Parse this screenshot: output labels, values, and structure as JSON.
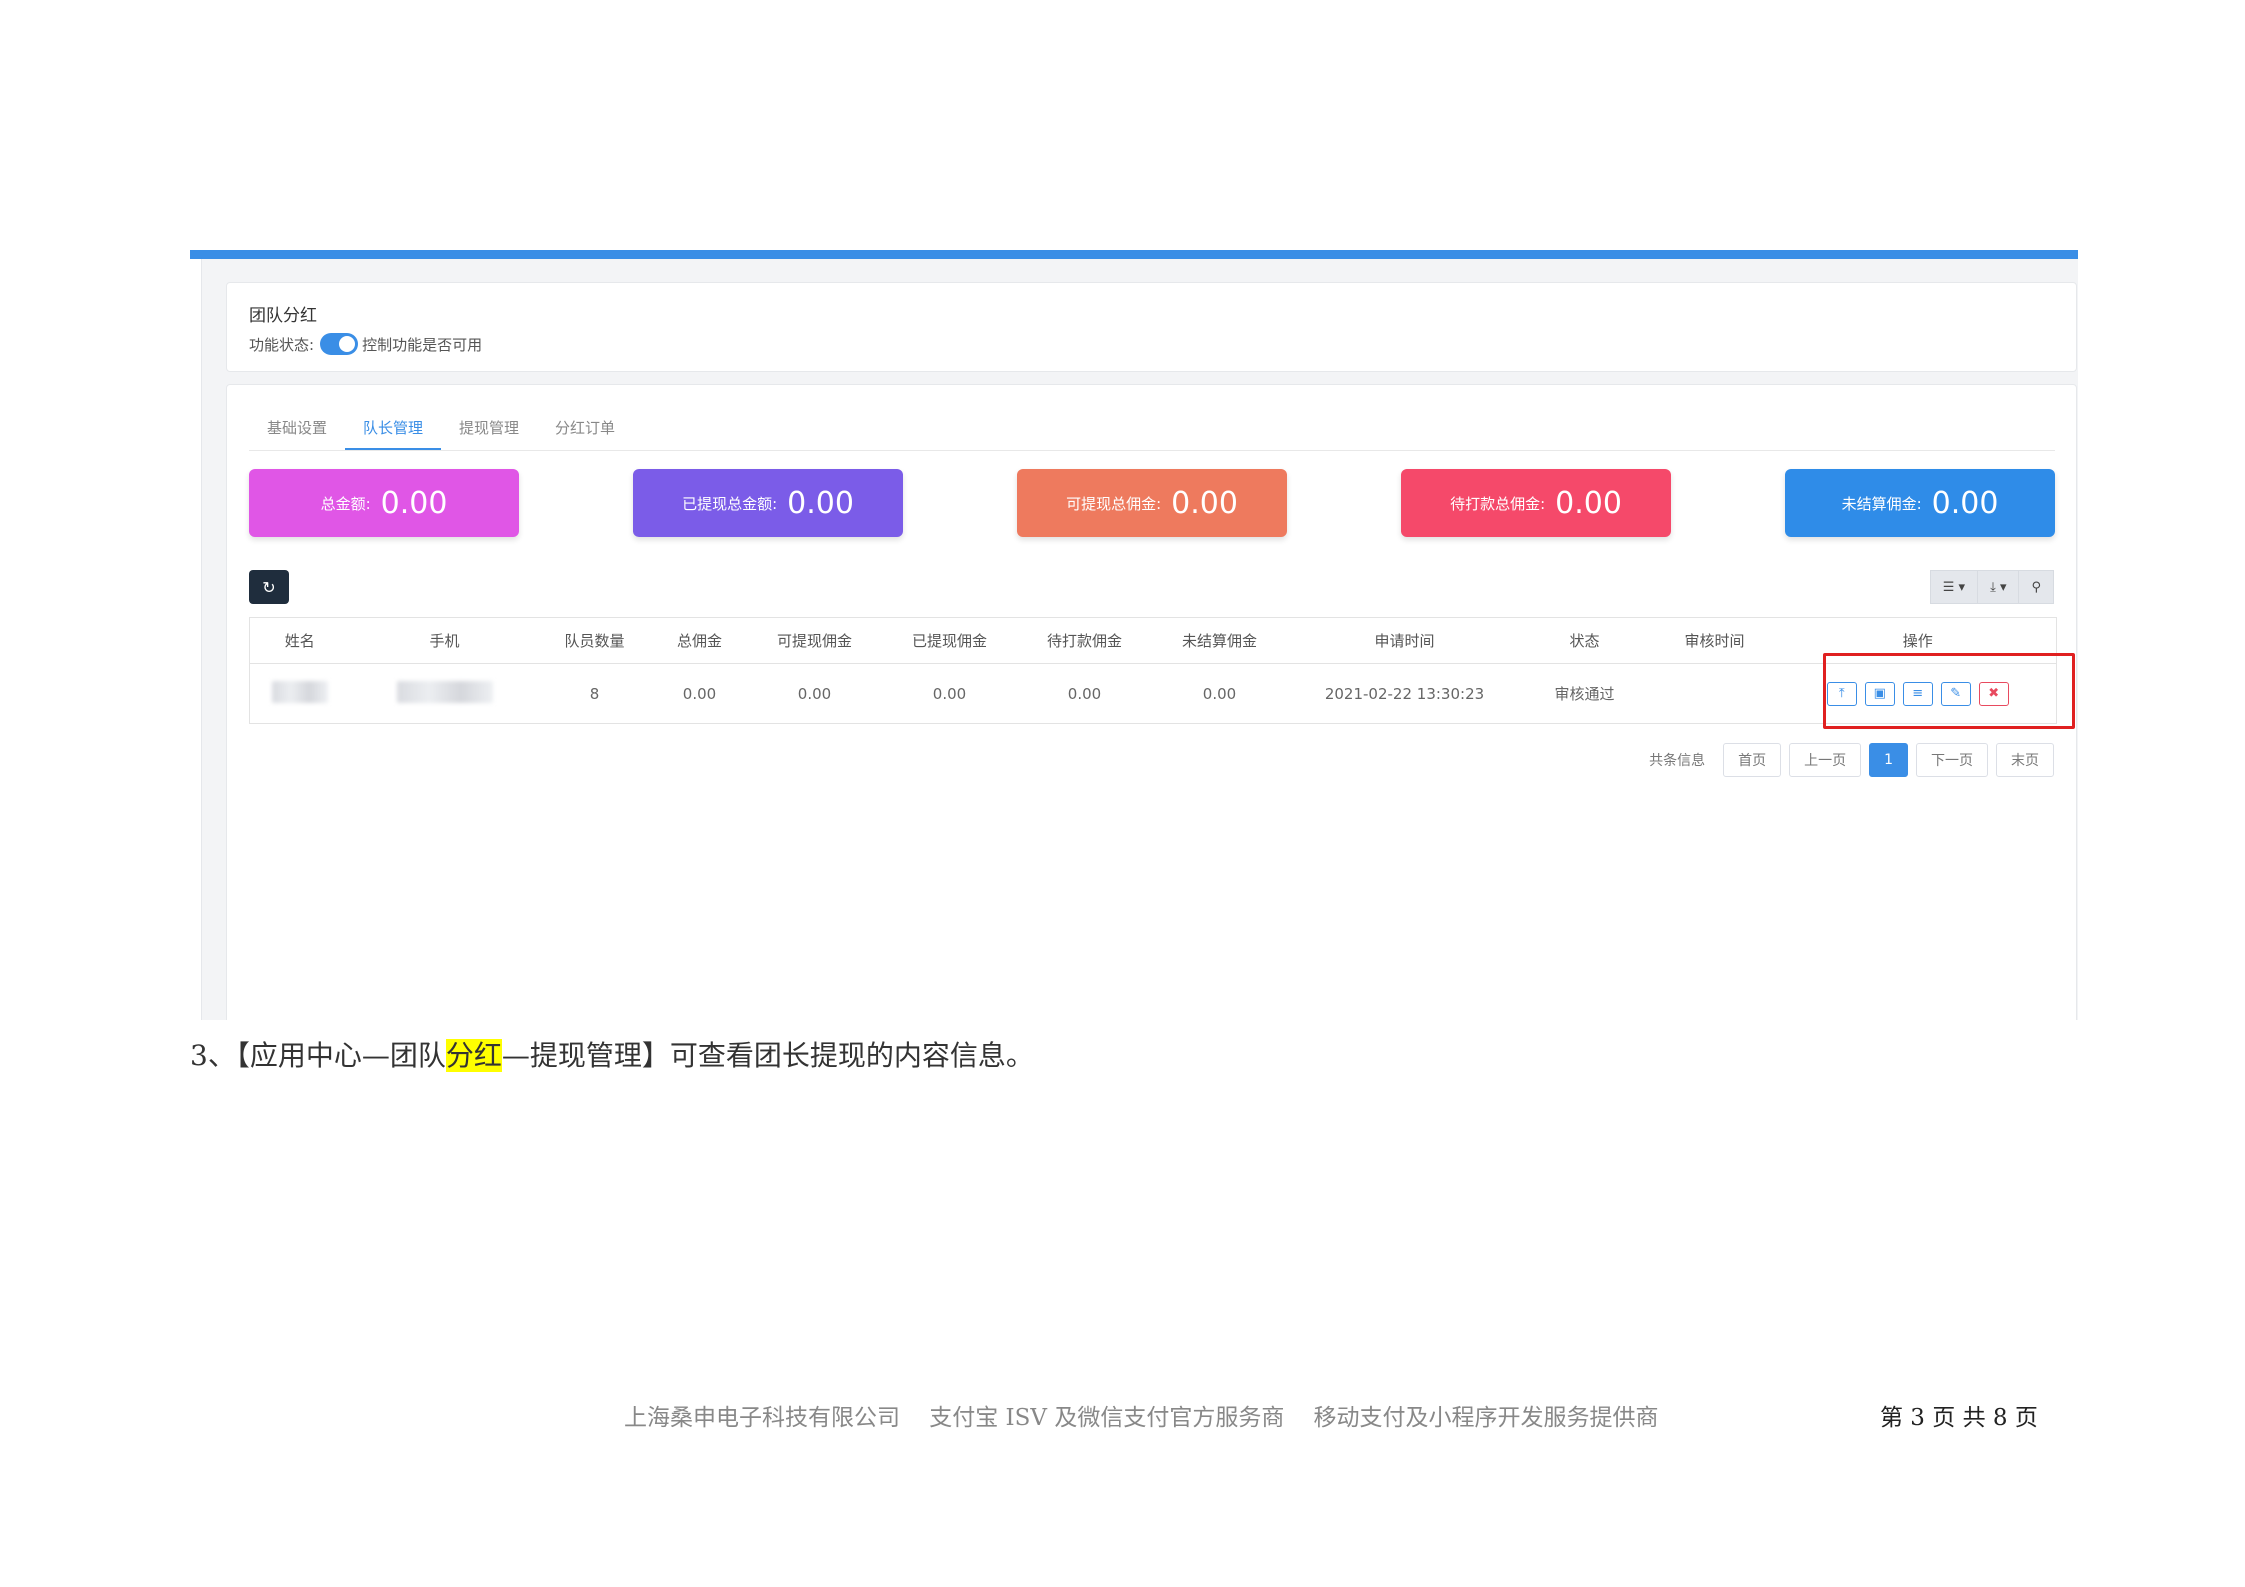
{
  "screenshot": {
    "header": {
      "title": "团队分红",
      "status_label": "功能状态:",
      "toggle_label": "控制功能是否可用",
      "toggle_on": true
    },
    "tabs": [
      {
        "label": "基础设置",
        "active": false
      },
      {
        "label": "队长管理",
        "active": true
      },
      {
        "label": "提现管理",
        "active": false
      },
      {
        "label": "分红订单",
        "active": false
      }
    ],
    "stats": [
      {
        "label": "总金额:",
        "value": "0.00",
        "color": "#e056e6"
      },
      {
        "label": "已提现总金额:",
        "value": "0.00",
        "color": "#7b5ce8"
      },
      {
        "label": "可提现总佣金:",
        "value": "0.00",
        "color": "#ee7a5e"
      },
      {
        "label": "待打款总佣金:",
        "value": "0.00",
        "color": "#f5496a"
      },
      {
        "label": "未结算佣金:",
        "value": "0.00",
        "color": "#2f8ce8"
      }
    ],
    "toolbar": {
      "refresh_icon": "refresh-icon",
      "columns_icon": "columns-icon",
      "export_icon": "export-icon",
      "search_icon": "search-icon"
    },
    "table": {
      "columns": [
        "姓名",
        "手机",
        "队员数量",
        "总佣金",
        "可提现佣金",
        "已提现佣金",
        "待打款佣金",
        "未结算佣金",
        "申请时间",
        "状态",
        "审核时间",
        "操作"
      ],
      "rows": [
        {
          "name": "",
          "phone": "",
          "members": "8",
          "total": "0.00",
          "withdrawable": "0.00",
          "withdrawn": "0.00",
          "pending": "0.00",
          "unsettled": "0.00",
          "applied_at": "2021-02-22 13:30:23",
          "status": "审核通过",
          "reviewed_at": "",
          "actions": [
            "upload-icon",
            "money-icon",
            "list-icon",
            "edit-icon",
            "delete-icon"
          ]
        }
      ]
    },
    "pager": {
      "summary": "共条信息",
      "first": "首页",
      "prev": "上一页",
      "current": "1",
      "next": "下一页",
      "last": "末页"
    }
  },
  "document": {
    "step_prefix": "3、【应用中心—团队",
    "step_mark": "分红",
    "step_suffix": "—提现管理】可查看团长提现的内容信息。",
    "footer": "上海桑申电子科技有限公司    支付宝 ISV 及微信支付官方服务商    移动支付及小程序开发服务提供商",
    "page_label": "第 3 页 共 8 页"
  }
}
